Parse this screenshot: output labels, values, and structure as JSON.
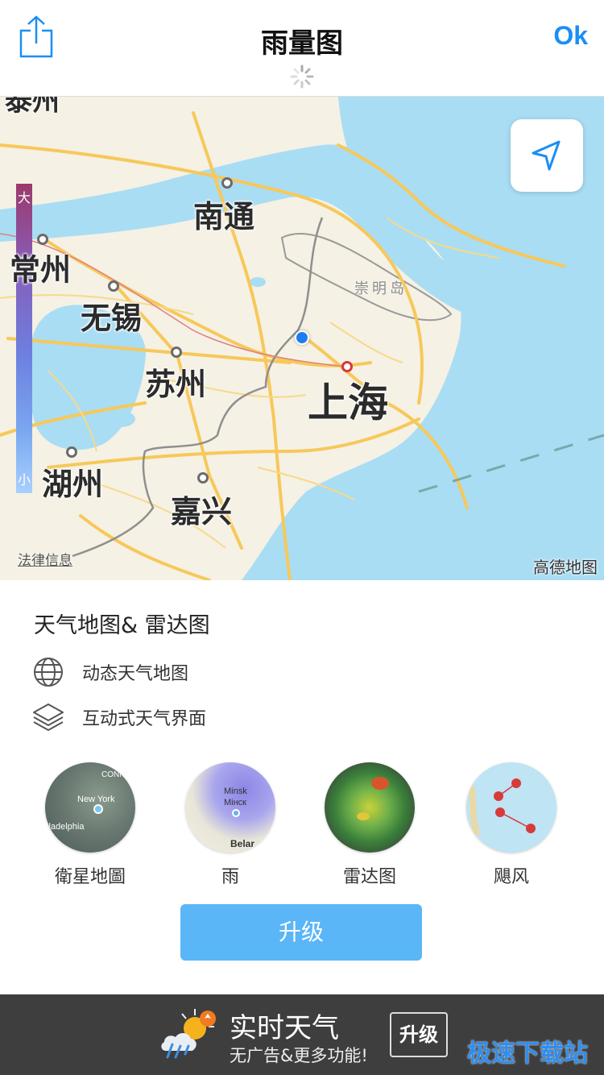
{
  "nav": {
    "title": "雨量图",
    "ok_label": "Ok"
  },
  "map": {
    "legend_max": "大",
    "legend_min": "小",
    "cities": {
      "taizhou_partial": "泰州",
      "nantong": "南通",
      "changzhou": "常州",
      "wuxi": "无锡",
      "suzhou": "苏州",
      "shanghai": "上海",
      "huzhou": "湖州",
      "jiaxing": "嘉兴",
      "chongming": "崇明岛"
    },
    "legal_link": "法律信息",
    "brand": "高德地图"
  },
  "promo": {
    "title": "天气地图& 雷达图",
    "features": [
      {
        "icon": "globe-icon",
        "label": "动态天气地图"
      },
      {
        "icon": "layers-icon",
        "label": "互动式天气界面"
      }
    ],
    "options": [
      {
        "label": "衛星地圖",
        "thumb_text": [
          "CONN",
          "New York",
          "iladelphia"
        ]
      },
      {
        "label": "雨",
        "thumb_text": [
          "Minsk",
          "Мінск",
          "Belar"
        ]
      },
      {
        "label": "雷达图",
        "thumb_text": []
      },
      {
        "label": "飓风",
        "thumb_text": []
      }
    ],
    "upgrade_label": "升级"
  },
  "ad": {
    "title": "实时天气",
    "subtitle": "无广告&更多功能!",
    "button_label": "升级"
  },
  "watermark": "极速下载站",
  "colors": {
    "accent": "#1a8ef5",
    "button": "#5ab6f7",
    "ad_bg": "#3e3e3e",
    "sea": "#a9ddf3",
    "land": "#f5f1e4",
    "road": "#f7c85a"
  }
}
